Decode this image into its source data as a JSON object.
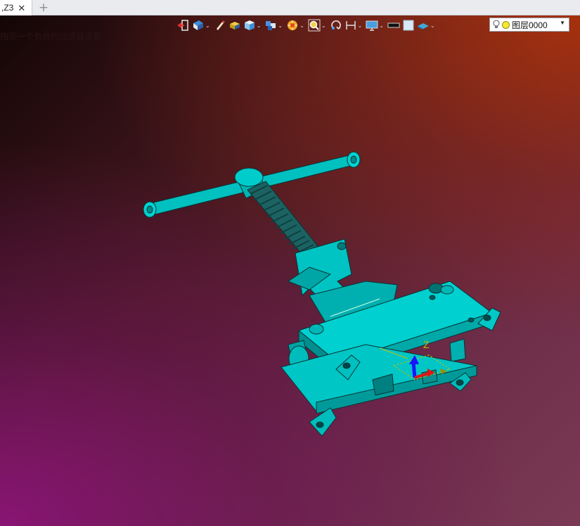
{
  "tab": {
    "title": ",Z3",
    "close_glyph": "✕",
    "new_tab_glyph": "+"
  },
  "viewport": {
    "prompt": "指示一个有效的过滤器设置.",
    "triad_z_label": "Z",
    "colors": {
      "model": "#00c8c8",
      "triad_z": "#1515ff",
      "triad_x": "#e01515",
      "triad_y": "#d7d000"
    }
  },
  "toolbar": {
    "icons": [
      "exit-icon",
      "display-mode-icon",
      "pencil-icon",
      "box-yellow-icon",
      "cube-icon",
      "views-icon",
      "render-style-icon",
      "zoom-icon",
      "rotate-icon",
      "measure-icon",
      "monitor-icon",
      "black-rectangle-icon",
      "white-square-icon",
      "plane-icon"
    ],
    "dropdown_glyph": "⌄"
  },
  "layer": {
    "name": "图层0000",
    "dropdown_glyph": "▼"
  }
}
